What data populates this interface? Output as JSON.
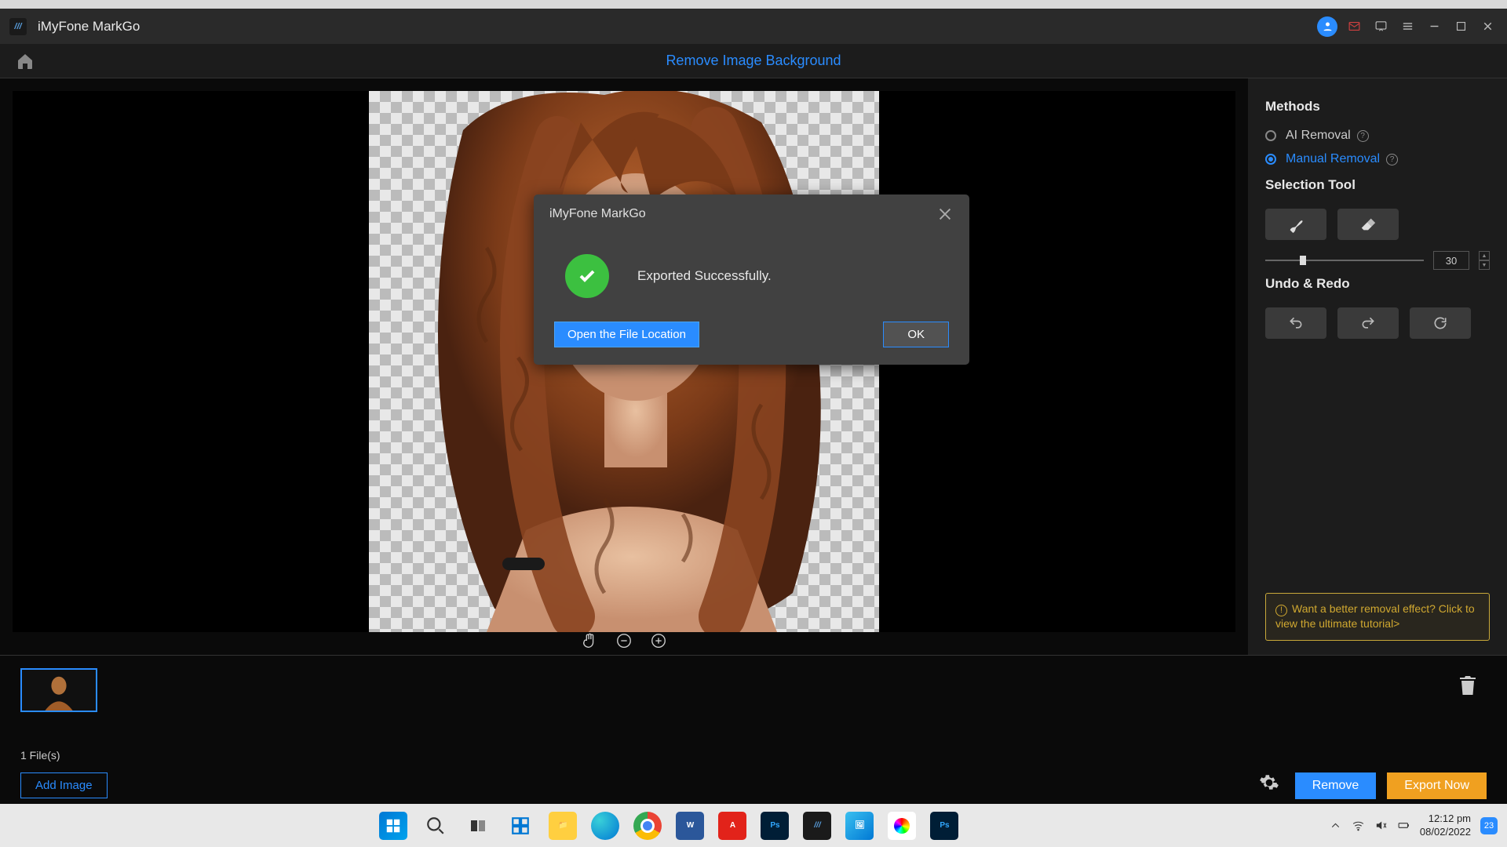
{
  "titlebar": {
    "appName": "iMyFone MarkGo"
  },
  "toolbar": {
    "centerTitle": "Remove Image Background"
  },
  "panel": {
    "methodsHeader": "Methods",
    "aiRemoval": "AI Removal",
    "manualRemoval": "Manual Removal",
    "selectionToolHeader": "Selection Tool",
    "sliderValue": "30",
    "undoRedoHeader": "Undo & Redo",
    "tutorialText": "Want a better removal effect? Click to view the ultimate tutorial>"
  },
  "thumbs": {
    "count": "1 File(s)"
  },
  "bottom": {
    "addImage": "Add Image",
    "remove": "Remove",
    "exportNow": "Export Now"
  },
  "modal": {
    "title": "iMyFone MarkGo",
    "message": "Exported Successfully.",
    "openLocation": "Open the File Location",
    "ok": "OK"
  },
  "taskbar": {
    "time": "12:12 pm",
    "date": "08/02/2022",
    "notif": "23"
  }
}
